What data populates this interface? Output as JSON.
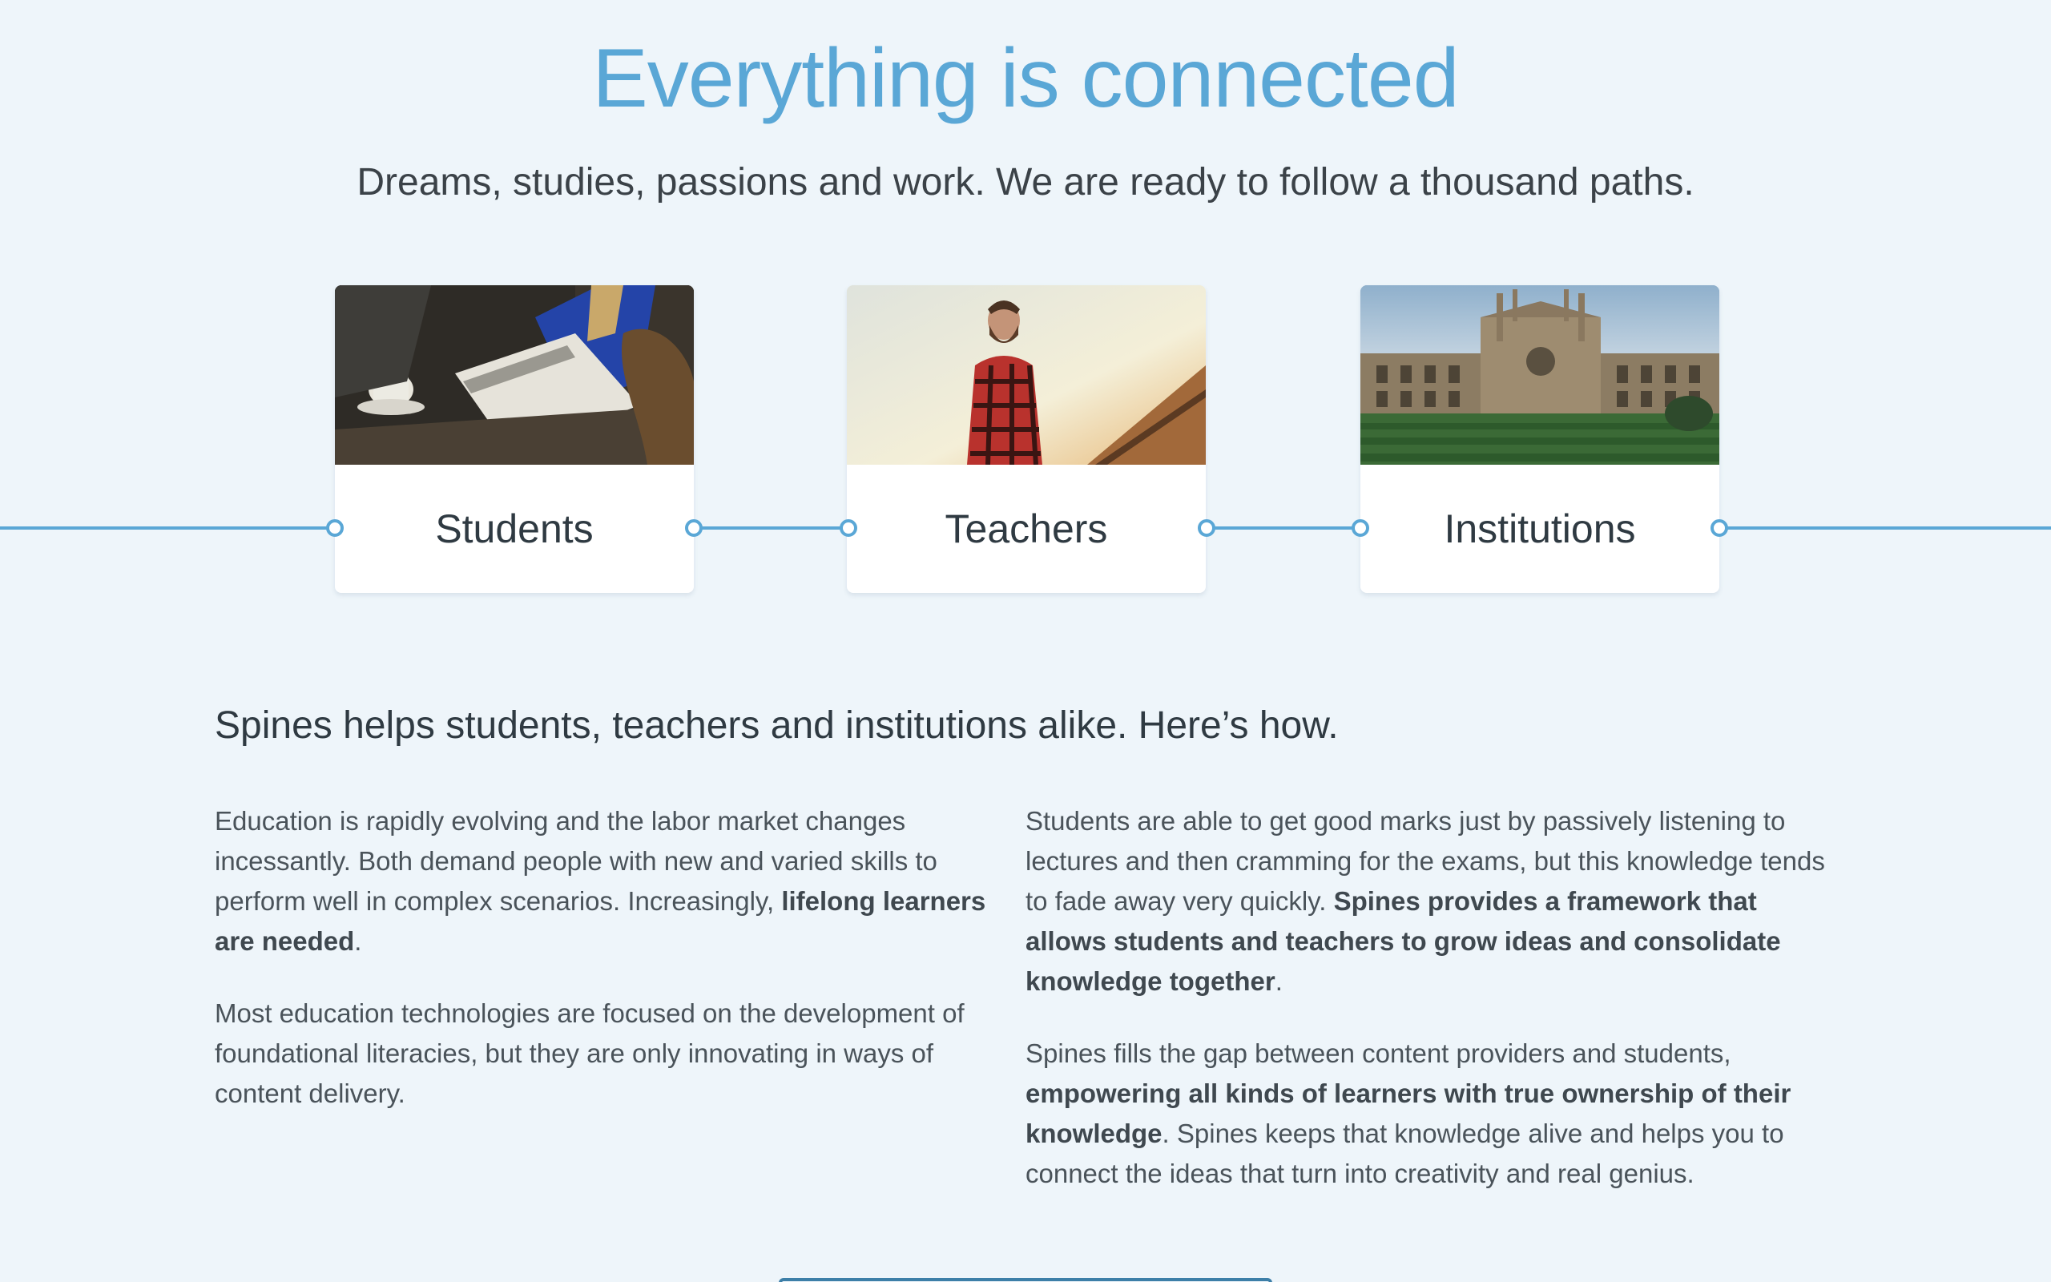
{
  "hero": {
    "title": "Everything is connected",
    "subtitle": "Dreams, studies, passions and work. We are ready to follow a thousand paths."
  },
  "cards": [
    {
      "label": "Students",
      "image": "students-photo"
    },
    {
      "label": "Teachers",
      "image": "teacher-photo"
    },
    {
      "label": "Institutions",
      "image": "institution-photo"
    }
  ],
  "section": {
    "heading": "Spines helps students, teachers and institutions alike. Here’s how.",
    "left": {
      "p1_text": "Education is rapidly evolving and the labor market changes incessantly. Both demand people with new and varied skills to perform well in complex scenarios. Increasingly, ",
      "p1_bold": "lifelong learners are needed",
      "p1_end": ".",
      "p2_text": "Most education technologies are focused on the development of foundational literacies, but they are only innovating in ways of content delivery."
    },
    "right": {
      "p1_text": "Students are able to get good marks just by passively listening to lectures and then cramming for the exams, but this knowledge tends to fade away very quickly. ",
      "p1_bold": "Spines provides a framework that allows students and teachers to grow ideas and consolidate knowledge together",
      "p1_end": ".",
      "p2_text": "Spines fills the gap between content providers and students, ",
      "p2_bold": "empowering all kinds of learners with true ownership of their knowledge",
      "p2_end": ". Spines keeps that knowledge alive and helps you to connect the ideas that turn into creativity and real genius."
    }
  },
  "colors": {
    "accent": "#5aa7d6",
    "background": "#eef5fa",
    "text": "#3f4a52"
  }
}
